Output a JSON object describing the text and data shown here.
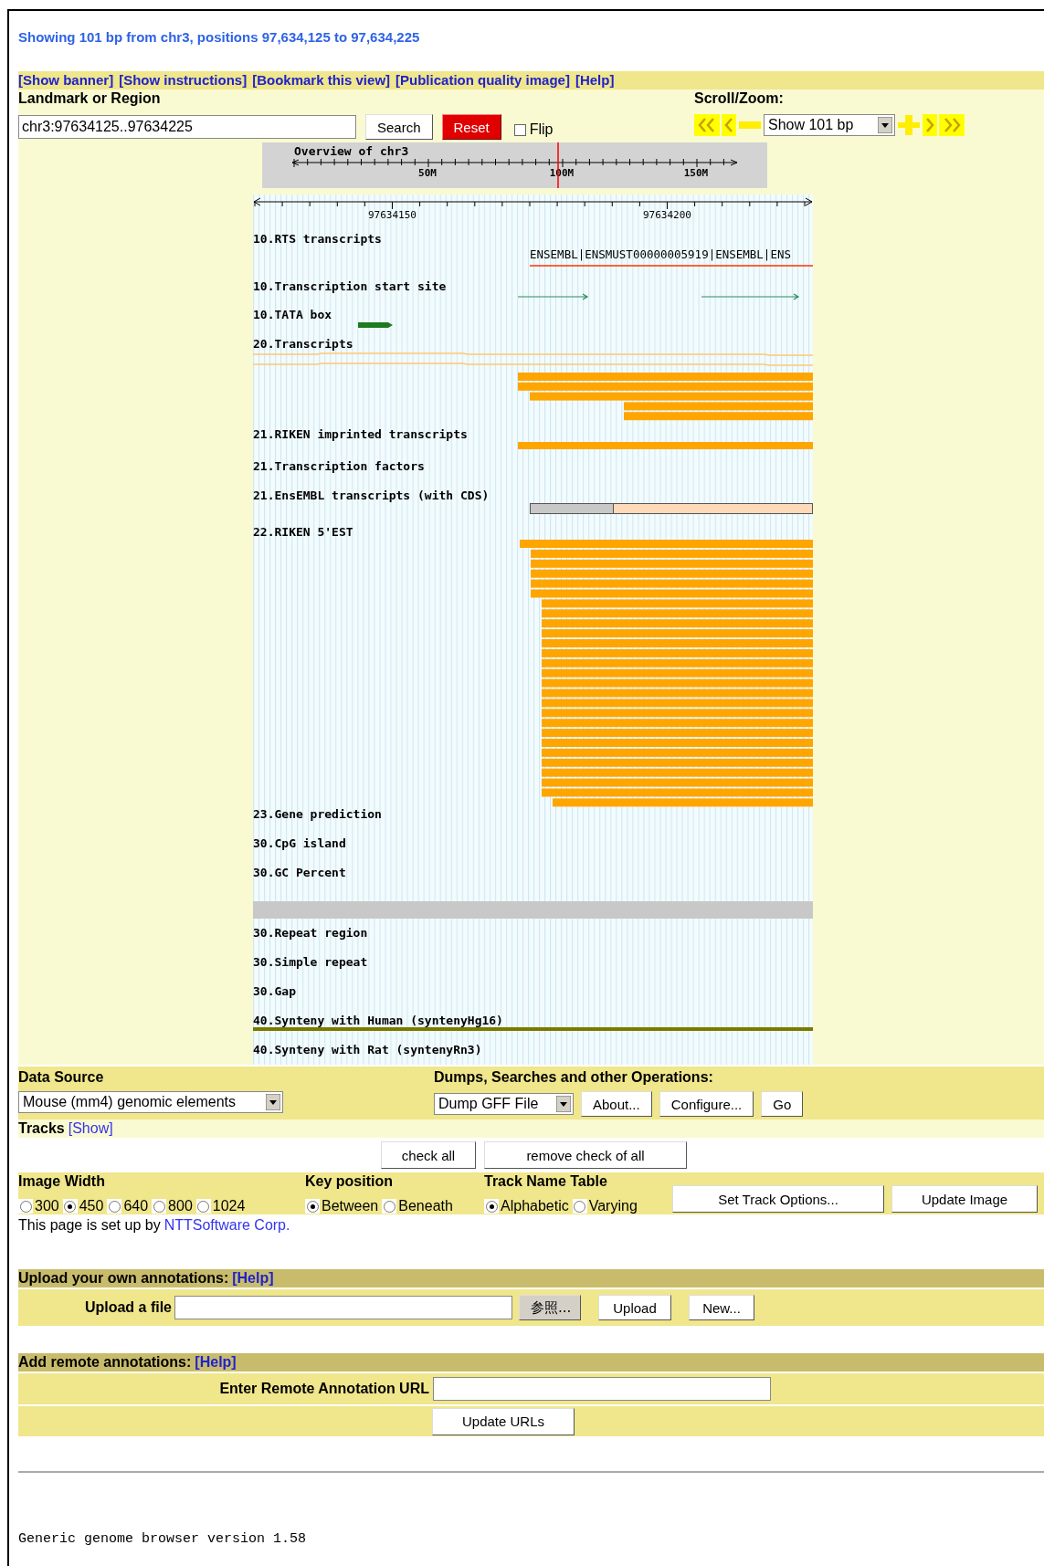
{
  "title": "Showing 101 bp from chr3, positions 97,634,125 to 97,634,225",
  "links": [
    "[Show banner]",
    "[Show instructions]",
    "[Bookmark this view]",
    "[Publication quality image]",
    "[Help]"
  ],
  "search": {
    "label": "Landmark or Region",
    "value": "chr3:97634125..97634225",
    "search_button": "Search",
    "reset_button": "Reset",
    "flip": {
      "label": "Flip",
      "checked": false
    }
  },
  "scroll_zoom": {
    "label": "Scroll/Zoom:",
    "value": "Show 101 bp"
  },
  "overview": {
    "title": "Overview of chr3",
    "ticks": [
      "50M",
      "100M",
      "150M"
    ]
  },
  "ruler": {
    "ticks": [
      "97634150",
      "97634200"
    ]
  },
  "tracks": [
    {
      "label": "10.RTS transcripts",
      "kind": "labeled_line",
      "feature_label": "ENSEMBL|ENSMUST00000005919|ENSEMBL|ENS"
    },
    {
      "label": "10.Transcription start site",
      "kind": "arrows"
    },
    {
      "label": "10.TATA box",
      "kind": "tata"
    },
    {
      "label": "20.Transcripts",
      "kind": "transcripts"
    },
    {
      "label": "21.RIKEN imprinted transcripts",
      "kind": "bar"
    },
    {
      "label": "21.Transcription factors",
      "kind": "none"
    },
    {
      "label": "21.EnsEMBL transcripts (with CDS)",
      "kind": "cds"
    },
    {
      "label": "22.RIKEN 5'EST",
      "kind": "est"
    },
    {
      "label": "23.Gene prediction",
      "kind": "none"
    },
    {
      "label": "30.CpG island",
      "kind": "none"
    },
    {
      "label": "30.GC Percent",
      "kind": "gc"
    },
    {
      "label": "30.Repeat region",
      "kind": "none"
    },
    {
      "label": "30.Simple repeat",
      "kind": "none"
    },
    {
      "label": "30.Gap",
      "kind": "none"
    },
    {
      "label": "40.Synteny with Human (syntenyHg16)",
      "kind": "line"
    },
    {
      "label": "40.Synteny with Rat (syntenyRn3)",
      "kind": "none"
    }
  ],
  "data_source": {
    "label": "Data Source",
    "value": "Mouse (mm4) genomic elements"
  },
  "operations": {
    "label": "Dumps, Searches and other Operations:",
    "value": "Dump GFF File",
    "buttons": [
      "About...",
      "Configure...",
      "Go"
    ]
  },
  "tracks_toggle": {
    "label": "Tracks",
    "link": "[Show]"
  },
  "track_buttons": [
    "check all",
    "remove check of all"
  ],
  "image_width": {
    "label": "Image Width",
    "options": [
      {
        "label": "300",
        "selected": false
      },
      {
        "label": "450",
        "selected": true
      },
      {
        "label": "640",
        "selected": false
      },
      {
        "label": "800",
        "selected": false
      },
      {
        "label": "1024",
        "selected": false
      }
    ]
  },
  "key_position": {
    "label": "Key position",
    "options": [
      {
        "label": "Between",
        "selected": true
      },
      {
        "label": "Beneath",
        "selected": false
      }
    ]
  },
  "track_name_table": {
    "label": "Track Name Table",
    "options": [
      {
        "label": "Alphabetic",
        "selected": true
      },
      {
        "label": "Varying",
        "selected": false
      }
    ]
  },
  "option_buttons": [
    "Set Track Options...",
    "Update Image"
  ],
  "credit": {
    "text": "This page is set up by",
    "link": "NTTSoftware Corp."
  },
  "upload": {
    "heading": "Upload your own annotations:",
    "help": "[Help]",
    "label": "Upload a file",
    "browse": "参照...",
    "buttons": [
      "Upload",
      "New..."
    ]
  },
  "remote": {
    "heading": "Add remote annotations:",
    "help": "[Help]",
    "label": "Enter Remote Annotation URL",
    "button": "Update URLs"
  },
  "footer": "Generic genome browser version 1.58"
}
